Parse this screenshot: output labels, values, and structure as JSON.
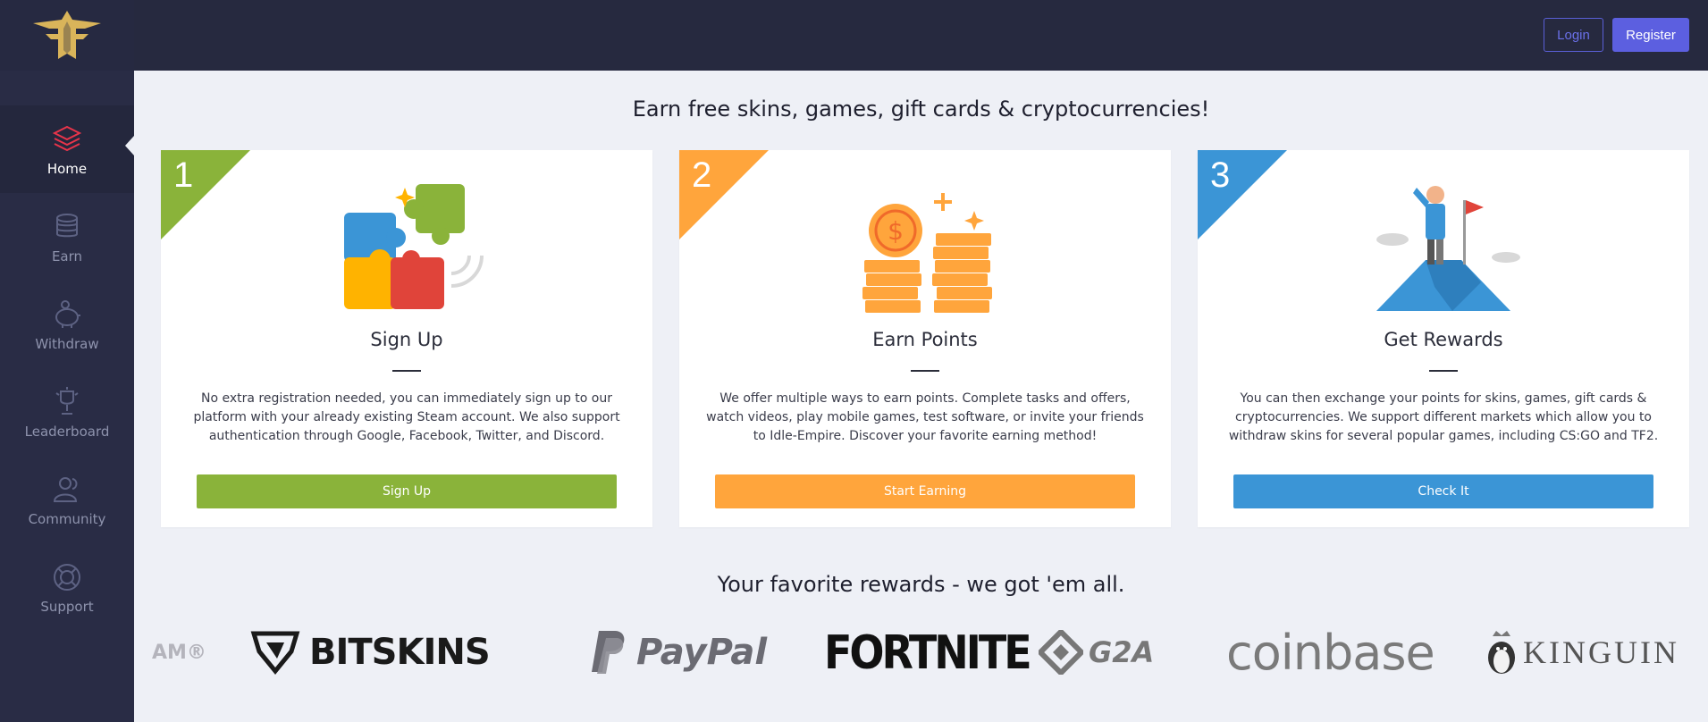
{
  "sidebar": {
    "logo_alt": "Idle-Empire",
    "items": [
      {
        "label": "Home",
        "icon": "layers-icon",
        "active": true
      },
      {
        "label": "Earn",
        "icon": "coins-icon",
        "active": false
      },
      {
        "label": "Withdraw",
        "icon": "piggy-bank-icon",
        "active": false
      },
      {
        "label": "Leaderboard",
        "icon": "trophy-icon",
        "active": false
      },
      {
        "label": "Community",
        "icon": "users-icon",
        "active": false
      },
      {
        "label": "Support",
        "icon": "lifebuoy-icon",
        "active": false
      }
    ]
  },
  "header": {
    "login_label": "Login",
    "register_label": "Register"
  },
  "hero": {
    "title": "Earn free skins, games, gift cards & cryptocurrencies!"
  },
  "steps": [
    {
      "number": "1",
      "title": "Sign Up",
      "text": "No extra registration needed, you can immediately sign up to our platform with your already existing Steam account. We also support authentication through Google, Facebook, Twitter, and Discord.",
      "button": "Sign Up",
      "color": "#8ab33a",
      "icon": "puzzle-icon"
    },
    {
      "number": "2",
      "title": "Earn Points",
      "text": "We offer multiple ways to earn points. Complete tasks and offers, watch videos, play mobile games, test software, or invite your friends to Idle-Empire. Discover your favorite earning method!",
      "button": "Start Earning",
      "color": "#ffa53c",
      "icon": "coin-stacks-icon"
    },
    {
      "number": "3",
      "title": "Get Rewards",
      "text": "You can then exchange your points for skins, games, gift cards & cryptocurrencies. We support different markets which allow you to withdraw skins for several popular games, including CS:GO and TF2.",
      "button": "Check It",
      "color": "#3b95d6",
      "icon": "mountain-flag-icon"
    }
  ],
  "rewards": {
    "title": "Your favorite rewards - we got 'em all.",
    "brands": [
      "AM®",
      "BITSKINS",
      "PayPal",
      "FORTNITE",
      "G2A",
      "coinbase",
      "KINGUIN"
    ]
  }
}
